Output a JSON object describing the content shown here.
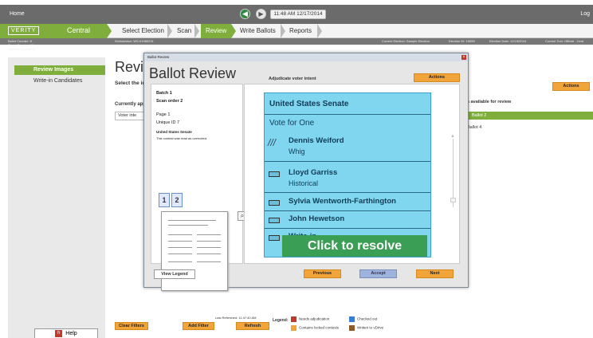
{
  "topbar": {
    "home": "Home",
    "login": "Log",
    "time": "11:48 AM 12/17/2014",
    "back_glyph": "◀",
    "forward_glyph": "▶"
  },
  "brand": {
    "logo": "VERITY",
    "product": "Central"
  },
  "workflow": {
    "steps": [
      "Select Election",
      "Scan",
      "Review",
      "Write Ballots",
      "Reports"
    ],
    "active_index": 2
  },
  "infobar": {
    "workstation": "Workstation: WS-01989231",
    "election": "Current Election: Sample Election",
    "election_id": "Election ID: 15555",
    "election_date": "Election Date: 12/15/2015",
    "test_mode": "Current Tool: Official - Cent"
  },
  "counters": {
    "ballot": "Ballot Counter: 8",
    "sheet": "Sheet Counter: 15",
    "lifetime": "Lifetime Counter: 8"
  },
  "sidebar": {
    "items": [
      {
        "label": "Review Images"
      },
      {
        "label": "Write-in Candidates"
      }
    ],
    "help": "Help"
  },
  "background": {
    "title": "Revie",
    "subtitle": "Select the ic",
    "current": "Currently app",
    "voter": "Voter inte",
    "actions": "Actions",
    "available": "s available for review",
    "ballot_selected": "Ballot 2",
    "ballot_other": "Ballot 4"
  },
  "bottom": {
    "clear_filters": "Clear Filters",
    "add_filter": "Add Filter",
    "refresh": "Refresh",
    "last_refreshed": "Last Refreshed: 11:47:40 AM",
    "legend_title": "Legend:",
    "legend": [
      {
        "label": "Needs adjudication",
        "color": "#c0392b"
      },
      {
        "label": "Checked out",
        "color": "#3a7bd5"
      },
      {
        "label": "Contains locked contests",
        "color": "#f1a43a"
      },
      {
        "label": "Written to vDrive",
        "color": "#8e5a2a"
      }
    ]
  },
  "modal": {
    "window_title": "Ballot Review",
    "title": "Ballot Review",
    "adjudicate": "Adjudicate voter intent",
    "actions": "Actions",
    "batch": "Batch  1",
    "scan_order": "Scan order  2",
    "page": "Page  1",
    "unique_id": "Unique ID  7",
    "contest": "United States Senate",
    "note": "This contest was read as overvoted.",
    "view_legend": "View Legend",
    "previous": "Previous",
    "accept": "Accept",
    "next": "Next",
    "resolve": "Click to resolve",
    "ballot": {
      "contest": "United States Senate",
      "vote_for": "Vote for One",
      "candidates": [
        {
          "name": "Dennis Weiford",
          "party": "Whig"
        },
        {
          "name": "Lloyd Garriss",
          "party": "Historical"
        },
        {
          "name": "Sylvia Wentworth-Farthington",
          "party": ""
        },
        {
          "name": "John Hewetson",
          "party": ""
        },
        {
          "name": "Write-in",
          "party": ""
        }
      ]
    }
  },
  "colors": {
    "brand_green": "#7fae3c",
    "actions_orange": "#f1a43a",
    "ballot_blue": "#7fd6ee",
    "resolve_green": "#3b9e55"
  }
}
